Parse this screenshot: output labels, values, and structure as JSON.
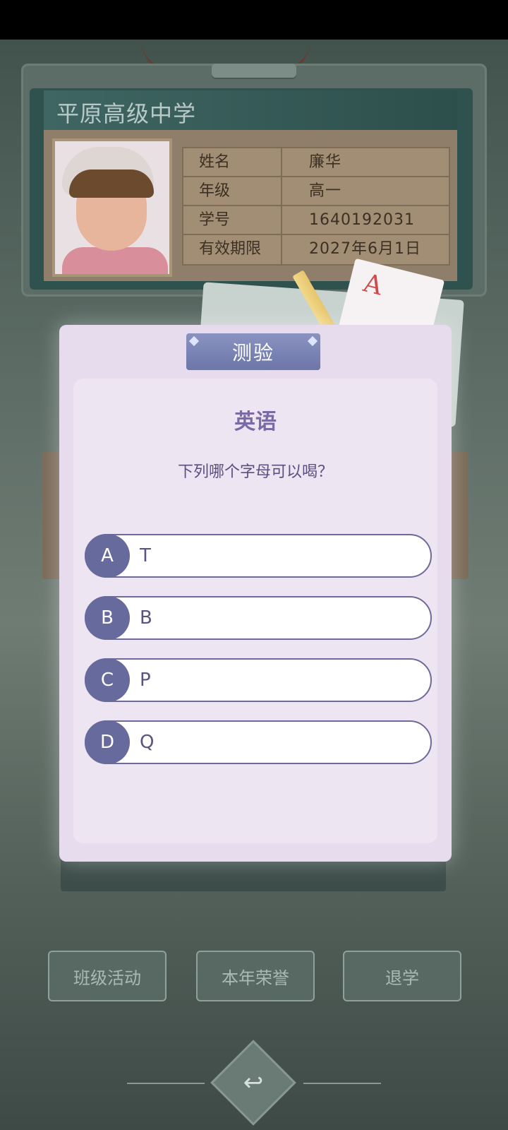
{
  "id_card": {
    "school_name": "平原高级中学",
    "fields": [
      {
        "label": "姓名",
        "value": "廉华"
      },
      {
        "label": "年级",
        "value": "高一"
      },
      {
        "label": "学号",
        "value": "1640192031"
      },
      {
        "label": "有效期限",
        "value": "2027年6月1日"
      }
    ]
  },
  "dialog": {
    "title": "测验",
    "subject": "英语",
    "question": "下列哪个字母可以喝？",
    "options": [
      {
        "key": "A",
        "text": "T"
      },
      {
        "key": "B",
        "text": "B"
      },
      {
        "key": "C",
        "text": "P"
      },
      {
        "key": "D",
        "text": "Q"
      }
    ]
  },
  "bottom_menu": {
    "class_activity": "班级活动",
    "annual_honors": "本年荣誉",
    "drop_out": "退学"
  },
  "decor": {
    "note_letter": "A"
  },
  "icons": {
    "back": "back-arrow-icon"
  }
}
